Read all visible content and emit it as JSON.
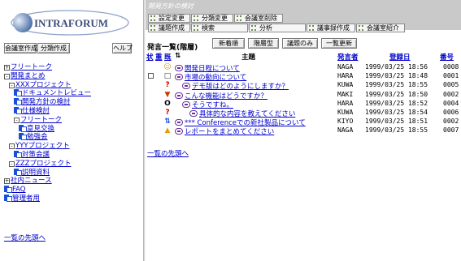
{
  "left": {
    "logo_text": "INTRAFORUM",
    "buttons": {
      "create_room": "会議室作成",
      "create_category": "分類作成",
      "help": "ヘルプ"
    },
    "tree": [
      {
        "indent": 0,
        "toggle": "+",
        "icon": "",
        "label": "フリートーク",
        "name": "tree-free-talk"
      },
      {
        "indent": 0,
        "toggle": "-",
        "icon": "",
        "label": "開発まとめ",
        "name": "tree-dev-summary"
      },
      {
        "indent": 1,
        "toggle": "-",
        "icon": "",
        "label": "XXXプロジェクト",
        "name": "tree-xxx-project"
      },
      {
        "indent": 2,
        "toggle": "",
        "icon": "doc",
        "label": "ドキュメントレビュー",
        "name": "tree-doc-review"
      },
      {
        "indent": 2,
        "toggle": "",
        "icon": "doc",
        "label": "開発方針の検討",
        "name": "tree-dev-policy"
      },
      {
        "indent": 2,
        "toggle": "",
        "icon": "doc",
        "label": "仕様検討",
        "name": "tree-spec-review"
      },
      {
        "indent": 2,
        "toggle": "-",
        "icon": "",
        "label": "フリートーク",
        "name": "tree-free-talk-sub"
      },
      {
        "indent": 3,
        "toggle": "",
        "icon": "doc",
        "label": "意見交換",
        "name": "tree-opinion-exchange"
      },
      {
        "indent": 3,
        "toggle": "",
        "icon": "doc",
        "label": "勉強会",
        "name": "tree-study-group"
      },
      {
        "indent": 1,
        "toggle": "-",
        "icon": "",
        "label": "YYYプロジェクト",
        "name": "tree-yyy-project"
      },
      {
        "indent": 2,
        "toggle": "",
        "icon": "doc",
        "label": "対策会議",
        "name": "tree-countermeasure"
      },
      {
        "indent": 1,
        "toggle": "-",
        "icon": "",
        "label": "ZZZプロジェクト",
        "name": "tree-zzz-project"
      },
      {
        "indent": 2,
        "toggle": "",
        "icon": "doc",
        "label": "説明資料",
        "name": "tree-explanation"
      },
      {
        "indent": 0,
        "toggle": "+",
        "icon": "",
        "label": "社内ニュース",
        "name": "tree-company-news"
      },
      {
        "indent": 0,
        "toggle": "",
        "icon": "doc",
        "label": "FAQ",
        "name": "tree-faq"
      },
      {
        "indent": 0,
        "toggle": "",
        "icon": "doc",
        "label": "管理者用",
        "name": "tree-admin"
      }
    ],
    "back_to_top": "一覧の先頭へ"
  },
  "right": {
    "context_title": "開発方針の検討",
    "toolbar_row1": [
      "設定変更",
      "分類変更",
      "会議室削除"
    ],
    "toolbar_row2": [
      "議題作成",
      "検索",
      "分析",
      "議事録作成",
      "会議室紹介"
    ],
    "list_title": "発言一覧(階層)",
    "list_buttons": [
      "新着順",
      "階層型",
      "議題のみ",
      "一覧更新"
    ],
    "columns": {
      "status": "状",
      "importance": "重",
      "read": "既",
      "subject": "主題",
      "author": "発言者",
      "date": "登録日",
      "number": "番号"
    },
    "rows": [
      {
        "indent": 0,
        "check": false,
        "icon": "person",
        "subject": "開発日程について",
        "author": "NAGA",
        "date": "1999/03/25 18:56",
        "number": "0008"
      },
      {
        "indent": 0,
        "check": true,
        "icon": "doc",
        "subject": "市場の動向について",
        "author": "HARA",
        "date": "1999/03/25 18:48",
        "number": "0001"
      },
      {
        "indent": 1,
        "check": false,
        "icon": "question",
        "subject": "デモ版はどのようにしますか？",
        "author": "KUWA",
        "date": "1999/03/25 18:55",
        "number": "0005"
      },
      {
        "indent": 0,
        "check": false,
        "icon": "thumbs-down",
        "subject": "こんな機能はどうですか？",
        "author": "MAKI",
        "date": "1999/03/25 18:50",
        "number": "0002"
      },
      {
        "indent": 1,
        "check": false,
        "icon": "circle",
        "subject": "そうですね。",
        "author": "HARA",
        "date": "1999/03/25 18:52",
        "number": "0004"
      },
      {
        "indent": 2,
        "check": false,
        "icon": "question",
        "subject": "具体的な内容を教えてください",
        "author": "KUWA",
        "date": "1999/03/25 18:54",
        "number": "0006"
      },
      {
        "indent": 0,
        "check": false,
        "icon": "arrows",
        "subject": "*** Conferenceでの新社製品について",
        "author": "KIYO",
        "date": "1999/03/25 18:51",
        "number": "0002"
      },
      {
        "indent": 0,
        "check": false,
        "icon": "bell-down",
        "subject": "レポートをまとめてください",
        "author": "NAGA",
        "date": "1999/03/25 18:55",
        "number": "0007"
      }
    ],
    "back_to_top": "一覧の先頭へ"
  },
  "colors": {
    "link": "#0000cc",
    "toolbar_bg": "#c9c9c9",
    "folder_blue": "#1a4fd6"
  }
}
